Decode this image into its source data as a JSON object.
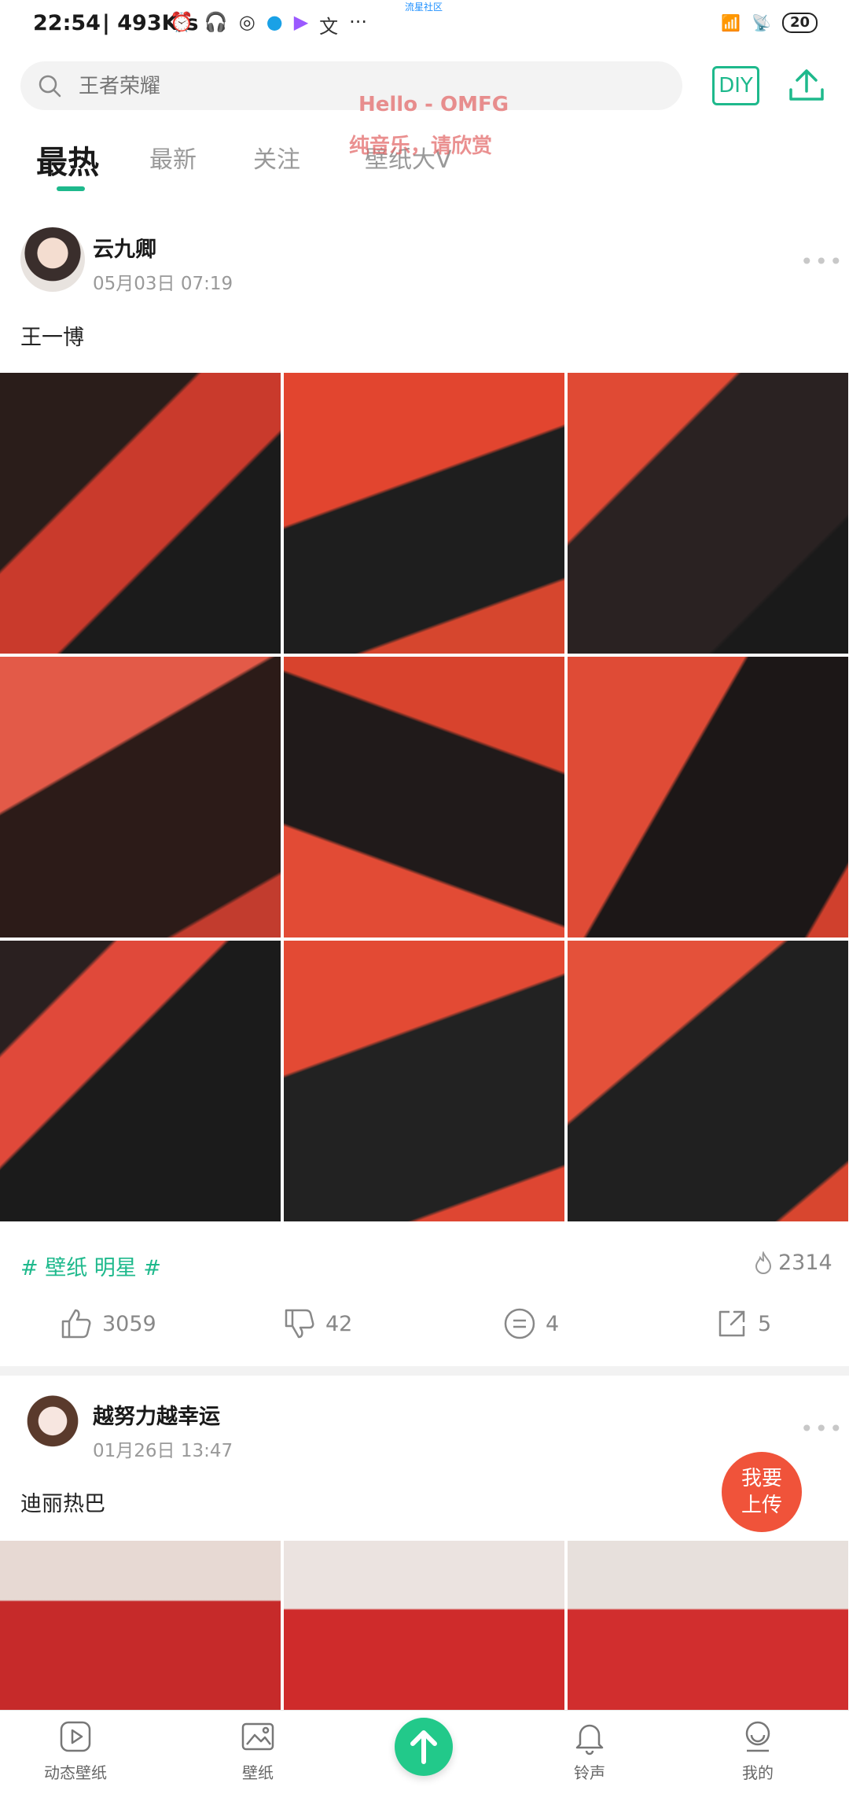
{
  "status_bar": {
    "time": "22:54",
    "speed": "| 493K/s",
    "battery": "20",
    "caption": "流星社区"
  },
  "search": {
    "placeholder": "王者荣耀"
  },
  "header": {
    "diy_label": "DIY"
  },
  "tabs": [
    {
      "label": "最热",
      "active": true
    },
    {
      "label": "最新",
      "active": false
    },
    {
      "label": "关注",
      "active": false
    },
    {
      "label": "壁纸大V",
      "active": false
    }
  ],
  "watermark": {
    "line1": "Hello - OMFG",
    "line2": "纯音乐，请欣赏"
  },
  "posts": [
    {
      "username": "云九卿",
      "time": "05月03日 07:19",
      "text": "王一博",
      "tags": "# 壁纸  明星 #",
      "heat": "2314",
      "likes": "3059",
      "dislikes": "42",
      "comments": "4",
      "shares": "5"
    },
    {
      "username": "越努力越幸运",
      "time": "01月26日 13:47",
      "text": "迪丽热巴"
    }
  ],
  "fab": {
    "line1": "我要",
    "line2": "上传"
  },
  "bottom_nav": [
    {
      "label": "动态壁纸"
    },
    {
      "label": "壁纸"
    },
    {
      "label": ""
    },
    {
      "label": "铃声"
    },
    {
      "label": "我的"
    }
  ],
  "colors": {
    "accent": "#1eb98c",
    "fab": "#f0533a",
    "upload": "#22c98a"
  }
}
